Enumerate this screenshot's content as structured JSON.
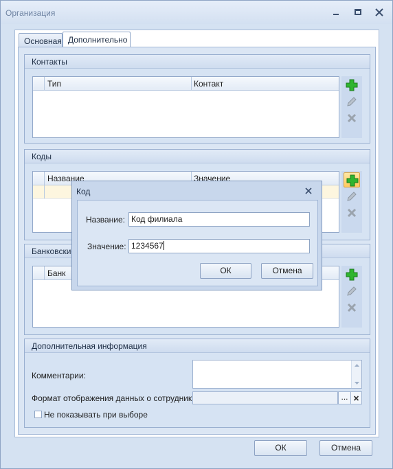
{
  "window": {
    "title": "Организация",
    "ok_label": "ОК",
    "cancel_label": "Отмена"
  },
  "tabs": [
    {
      "label": "Основная",
      "active": false
    },
    {
      "label": "Дополнительно",
      "active": true
    }
  ],
  "contacts": {
    "title": "Контакты",
    "columns": [
      "Тип",
      "Контакт"
    ]
  },
  "codes": {
    "title": "Коды",
    "columns": [
      "Название",
      "Значение"
    ]
  },
  "banks": {
    "title": "Банковские",
    "columns": [
      "Банк"
    ]
  },
  "extra": {
    "title": "Дополнительная информация",
    "comments_label": "Комментарии:",
    "format_label": "Формат отображения данных о сотрудниках",
    "format_button": "...",
    "hide_checkbox_label": "Не показывать при выборе",
    "hide_checked": false
  },
  "dialog": {
    "title": "Код",
    "name_label": "Название:",
    "name_value": "Код филиала",
    "value_label": "Значение:",
    "value_value": "1234567",
    "ok_label": "ОК",
    "cancel_label": "Отмена"
  },
  "colors": {
    "accent": "#d5e2f2",
    "add_icon": "#2fb52f",
    "highlight": "#ffc95e"
  },
  "icons": {
    "add": "plus-icon",
    "edit": "pencil-icon",
    "delete": "cross-icon",
    "close": "close-icon",
    "minimize": "minimize-icon",
    "maximize": "maximize-icon"
  }
}
